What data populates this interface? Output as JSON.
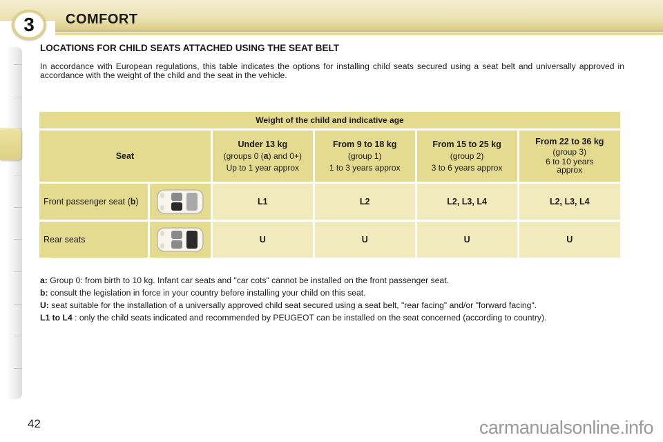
{
  "header": {
    "chapter_number": "3",
    "chapter_title": "COMFORT"
  },
  "section": {
    "title": "LOCATIONS FOR CHILD SEATS ATTACHED USING THE SEAT BELT",
    "intro": "In accordance with European regulations, this table indicates the options for installing child seats secured using a seat belt and universally approved in accordance with the weight of the child and the seat in the vehicle."
  },
  "table": {
    "span_header": "Weight of the child and indicative age",
    "seat_header": "Seat",
    "columns": [
      {
        "weight": "Under 13 kg",
        "group_prefix": "(groups 0 (",
        "group_ref": "a",
        "group_suffix": ") and 0+)",
        "age": "Up to 1 year approx"
      },
      {
        "weight": "From 9 to 18 kg",
        "group": "(group 1)",
        "age": "1 to 3 years approx"
      },
      {
        "weight": "From 15 to 25 kg",
        "group": "(group 2)",
        "age": "3 to 6 years approx"
      },
      {
        "weight": "From 22 to 36 kg",
        "group": "(group 3)",
        "age": "6 to 10 years approx"
      }
    ],
    "rows": [
      {
        "seat": "Front passenger seat (",
        "seat_ref": "b",
        "seat_suffix": ")",
        "icon": "car-top-view-front-passenger-highlighted",
        "values": [
          "L1",
          "L2",
          "L2, L3, L4",
          "L2, L3, L4"
        ]
      },
      {
        "seat": "Rear seats",
        "icon": "car-top-view-rear-seats-highlighted",
        "values": [
          "U",
          "U",
          "U",
          "U"
        ]
      }
    ]
  },
  "notes": [
    {
      "key": "a:",
      "text": "Group 0: from birth to 10 kg. Infant car seats and \"car cots\" cannot be installed on the front passenger seat."
    },
    {
      "key": "b:",
      "text": "consult the legislation in force in your country before installing your child on this seat."
    },
    {
      "key": "U:",
      "text": "seat suitable for the installation of a universally approved child seat secured using a seat belt, \"rear facing\" and/or \"forward facing\"."
    },
    {
      "key": "L1 to L4",
      "text": ": only the child seats indicated and recommended by PEUGEOT can be installed on the seat concerned (according to country)."
    }
  ],
  "footer": {
    "page_number": "42",
    "watermark": "carmanualsonline.info"
  },
  "colors": {
    "header_band": "#ece3b4",
    "table_header_cell": "#e5db90",
    "table_value_cell": "#f1eabd",
    "active_tab": "#e6db92"
  }
}
